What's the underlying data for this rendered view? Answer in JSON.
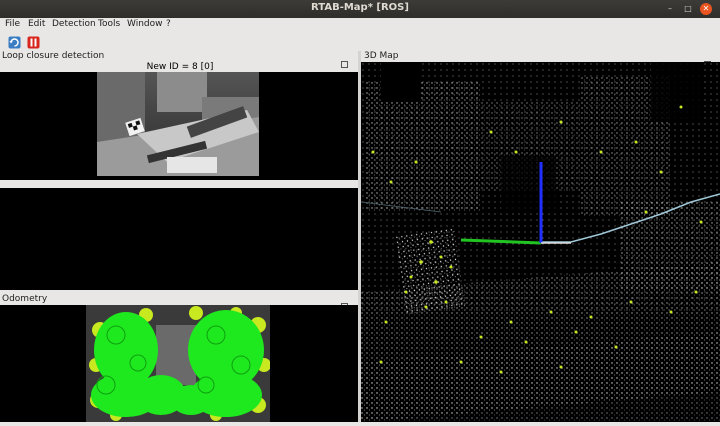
{
  "window": {
    "title": "RTAB-Map* [ROS]"
  },
  "menu": [
    "File",
    "Edit",
    "Detection",
    "Tools",
    "Window",
    "?"
  ],
  "toolbar": {
    "refresh_icon": "refresh-icon",
    "pause_icon": "pause-icon"
  },
  "panels": {
    "loop_closure": {
      "title": "Loop closure detection",
      "new_id": "New ID = 8 [0]"
    },
    "odometry": {
      "title": "Odometry"
    },
    "map3d": {
      "title": "3D Map"
    }
  },
  "colors": {
    "odometry_features": "#1ee81e",
    "map_features": "#c8e820",
    "axis_x": "#22c422",
    "axis_z": "#2030ff",
    "trajectory": "#9fc8d8"
  }
}
